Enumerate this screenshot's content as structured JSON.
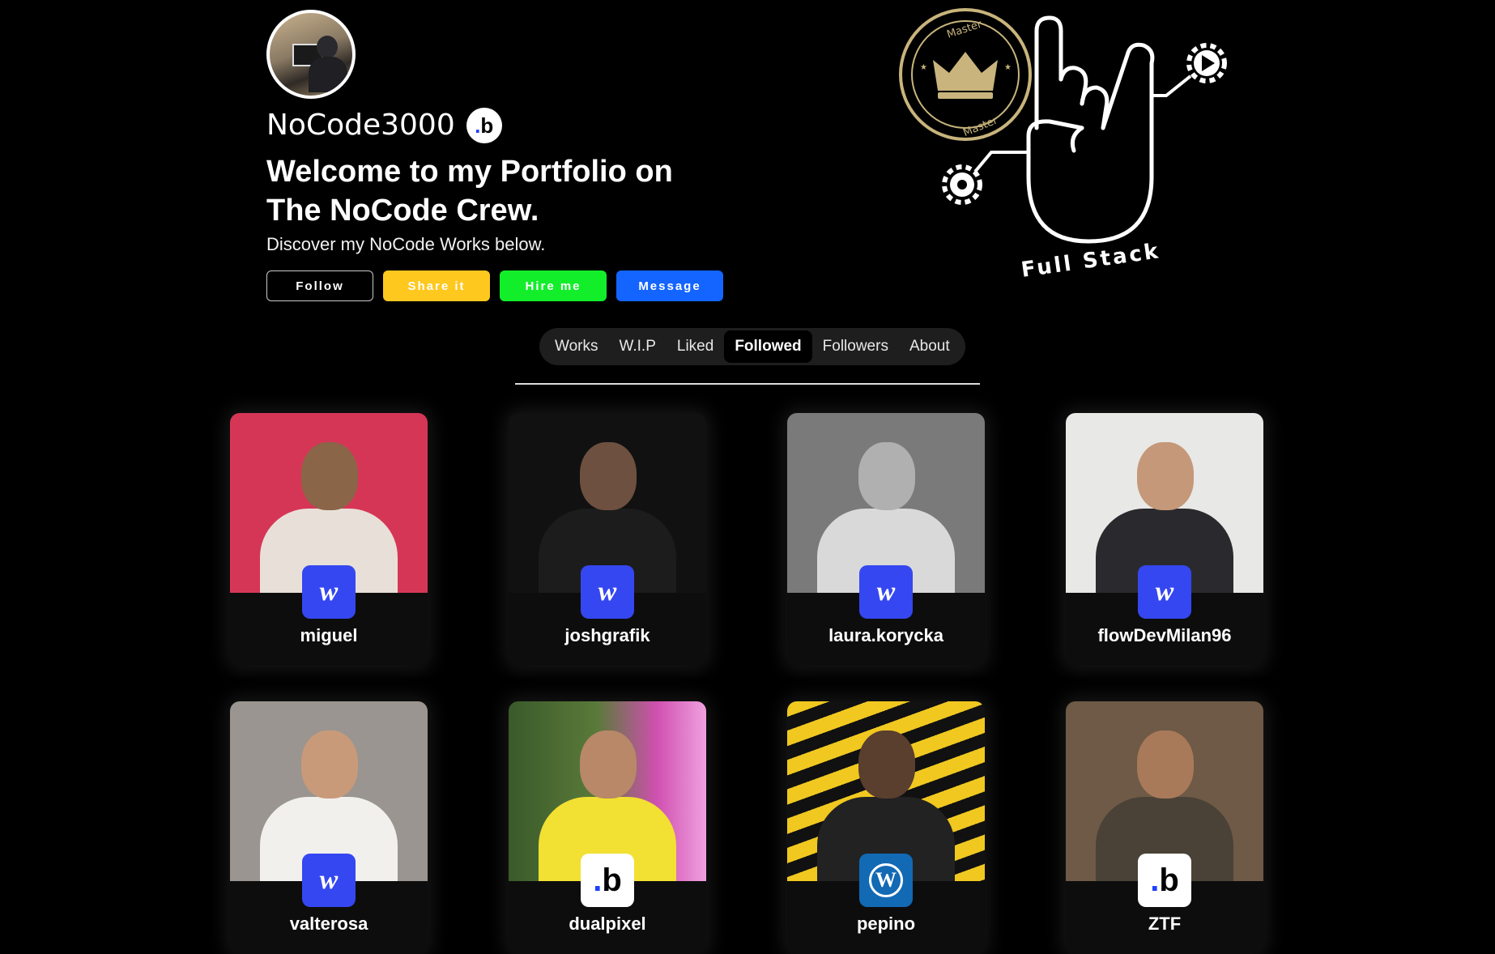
{
  "profile": {
    "username": "NoCode3000",
    "headline": "Welcome to my Portfolio on The NoCode Crew.",
    "subline": "Discover my NoCode Works below.",
    "badge_glyph": "b"
  },
  "actions": {
    "follow": "Follow",
    "share": "Share it",
    "hire": "Hire me",
    "message": "Message"
  },
  "hero": {
    "badge_top": "Master",
    "badge_bottom": "Master",
    "caption": "Full Stack"
  },
  "tabs": [
    {
      "label": "Works",
      "active": false
    },
    {
      "label": "W.I.P",
      "active": false
    },
    {
      "label": "Liked",
      "active": false
    },
    {
      "label": "Followed",
      "active": true
    },
    {
      "label": "Followers",
      "active": false
    },
    {
      "label": "About",
      "active": false
    }
  ],
  "followed": [
    {
      "name": "miguel",
      "platform": "webflow",
      "platform_glyph": "w"
    },
    {
      "name": "joshgrafik",
      "platform": "webflow",
      "platform_glyph": "w"
    },
    {
      "name": "laura.korycka",
      "platform": "webflow",
      "platform_glyph": "w"
    },
    {
      "name": "flowDevMilan96",
      "platform": "webflow",
      "platform_glyph": "w"
    },
    {
      "name": "valterosa",
      "platform": "webflow",
      "platform_glyph": "w"
    },
    {
      "name": "dualpixel",
      "platform": "bubble",
      "platform_glyph": "b"
    },
    {
      "name": "pepino",
      "platform": "wordpress",
      "platform_glyph": "W"
    },
    {
      "name": "ZTF",
      "platform": "bubble",
      "platform_glyph": "b"
    }
  ],
  "colors": {
    "background": "#000000",
    "share": "#ffc81e",
    "hire": "#13ee2b",
    "message": "#1464ff",
    "webflow": "#3547f0",
    "wordpress": "#1269b4",
    "gold": "#c8b47c"
  }
}
